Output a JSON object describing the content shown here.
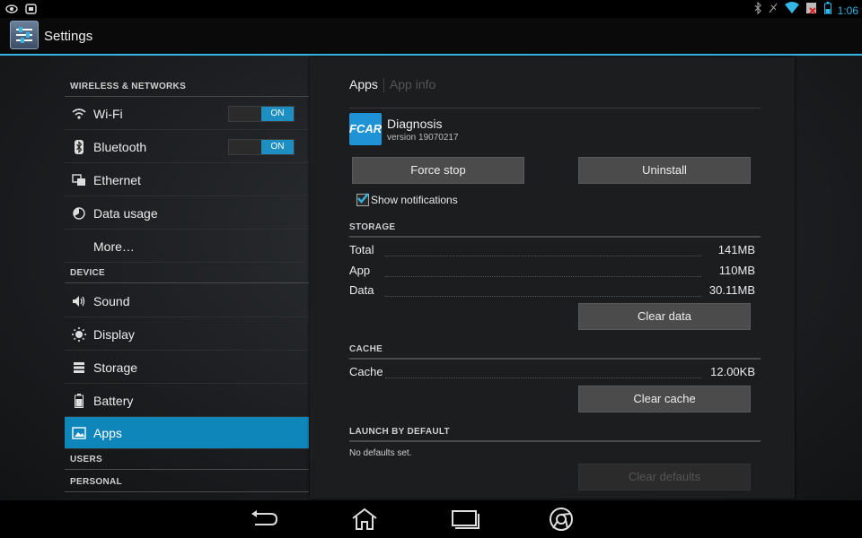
{
  "status_bar": {
    "time": "1:06",
    "icons": [
      "eye-icon",
      "screen-icon",
      "bluetooth-icon",
      "no-sound-icon",
      "wifi-icon",
      "no-sim-icon",
      "battery-icon"
    ]
  },
  "action_bar": {
    "title": "Settings",
    "icon": "settings-icon"
  },
  "sidebar": {
    "sections": [
      {
        "header": "WIRELESS & NETWORKS"
      },
      {
        "header": "DEVICE"
      },
      {
        "header": "USERS"
      },
      {
        "header": "PERSONAL"
      }
    ],
    "items": [
      {
        "label": "Wi-Fi",
        "icon": "wifi-icon",
        "toggle": "ON"
      },
      {
        "label": "Bluetooth",
        "icon": "bluetooth-icon",
        "toggle": "ON"
      },
      {
        "label": "Ethernet",
        "icon": "ethernet-icon"
      },
      {
        "label": "Data usage",
        "icon": "data-usage-icon"
      },
      {
        "label": "More…",
        "icon": ""
      },
      {
        "label": "Sound",
        "icon": "sound-icon"
      },
      {
        "label": "Display",
        "icon": "display-icon"
      },
      {
        "label": "Storage",
        "icon": "storage-icon"
      },
      {
        "label": "Battery",
        "icon": "battery-icon"
      },
      {
        "label": "Apps",
        "icon": "apps-icon",
        "selected": true
      }
    ]
  },
  "panel": {
    "breadcrumb": {
      "current": "Apps",
      "next": "App info"
    },
    "app": {
      "logo_text": "FCAR",
      "name": "Diagnosis",
      "version": "version 19070217"
    },
    "buttons": {
      "force_stop": "Force stop",
      "uninstall": "Uninstall",
      "clear_data": "Clear data",
      "clear_cache": "Clear cache",
      "clear_defaults": "Clear defaults"
    },
    "show_notifications": {
      "label": "Show notifications",
      "checked": true
    },
    "storage": {
      "header": "STORAGE",
      "rows": [
        {
          "label": "Total",
          "value": "141MB"
        },
        {
          "label": "App",
          "value": "110MB"
        },
        {
          "label": "Data",
          "value": "30.11MB"
        }
      ]
    },
    "cache": {
      "header": "CACHE",
      "label": "Cache",
      "value": "12.00KB"
    },
    "launch": {
      "header": "LAUNCH BY DEFAULT",
      "text": "No defaults set."
    }
  },
  "nav_bar": {
    "buttons": [
      "back-icon",
      "home-icon",
      "recents-icon",
      "chrome-icon"
    ]
  },
  "colors": {
    "accent": "#33b5e5",
    "selected": "#0f86ba",
    "toggle_on": "#1e8fc2",
    "fcar_logo": "#1f93d6"
  }
}
